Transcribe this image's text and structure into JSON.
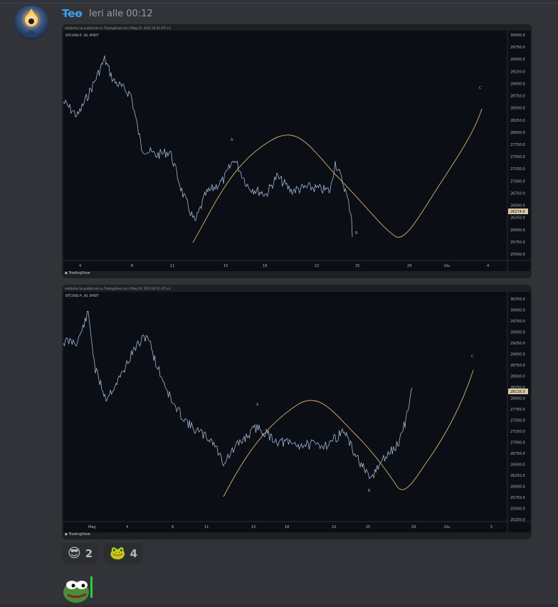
{
  "message": {
    "username": "Teo",
    "timestamp": "Ieri alle 00:12"
  },
  "charts": [
    {
      "header": "matdefee ha pubblicato su TradingView.com il Mag 24, 2023 16:34 UTC+2",
      "symbol": "BTCUSD.P, 30, BYBIT",
      "footer": "TradingView",
      "price_ticks": [
        "30000.0",
        "29750.0",
        "29500.0",
        "29250.0",
        "29000.0",
        "28750.0",
        "28500.0",
        "28250.0",
        "28000.0",
        "27750.0",
        "27500.0",
        "27250.0",
        "27000.0",
        "26750.0",
        "26500.0",
        "26250.0",
        "26000.0",
        "25750.0",
        "25500.0"
      ],
      "current_price": "26274.5",
      "date_ticks": [
        "4",
        "8",
        "11",
        "15",
        "18",
        "22",
        "25",
        "29",
        "Giu",
        "4"
      ],
      "wave_labels": [
        "A",
        "B",
        "C"
      ]
    },
    {
      "header": "matdefee ha pubblicato su TradingView.com il Mag 29, 2023 00:12 UTC+2",
      "symbol": "BTCUSD.P, 30, BYBIT",
      "footer": "TradingView",
      "price_ticks": [
        "30250.0",
        "30000.0",
        "29750.0",
        "29500.0",
        "29250.0",
        "29000.0",
        "28750.0",
        "28500.0",
        "28250.0",
        "28000.0",
        "27750.0",
        "27500.0",
        "27250.0",
        "27000.0",
        "26750.0",
        "26500.0",
        "26250.0",
        "26000.0",
        "25750.0",
        "25500.0",
        "25250.0"
      ],
      "current_price": "28116.0",
      "date_ticks": [
        "Mag",
        "4",
        "8",
        "11",
        "15",
        "18",
        "22",
        "25",
        "29",
        "Giu",
        "5"
      ],
      "wave_labels": [
        "A",
        "B",
        "C"
      ]
    }
  ],
  "reactions": [
    {
      "emoji": "😎",
      "count": "2"
    },
    {
      "emoji": "🐸",
      "count": "4"
    }
  ],
  "colors": {
    "background": "#313338",
    "username": "#3aa0f0",
    "wave_curve": "#c9a86a",
    "price_line": "#9fb7d9"
  },
  "sticker": "pepe-frog-icon"
}
